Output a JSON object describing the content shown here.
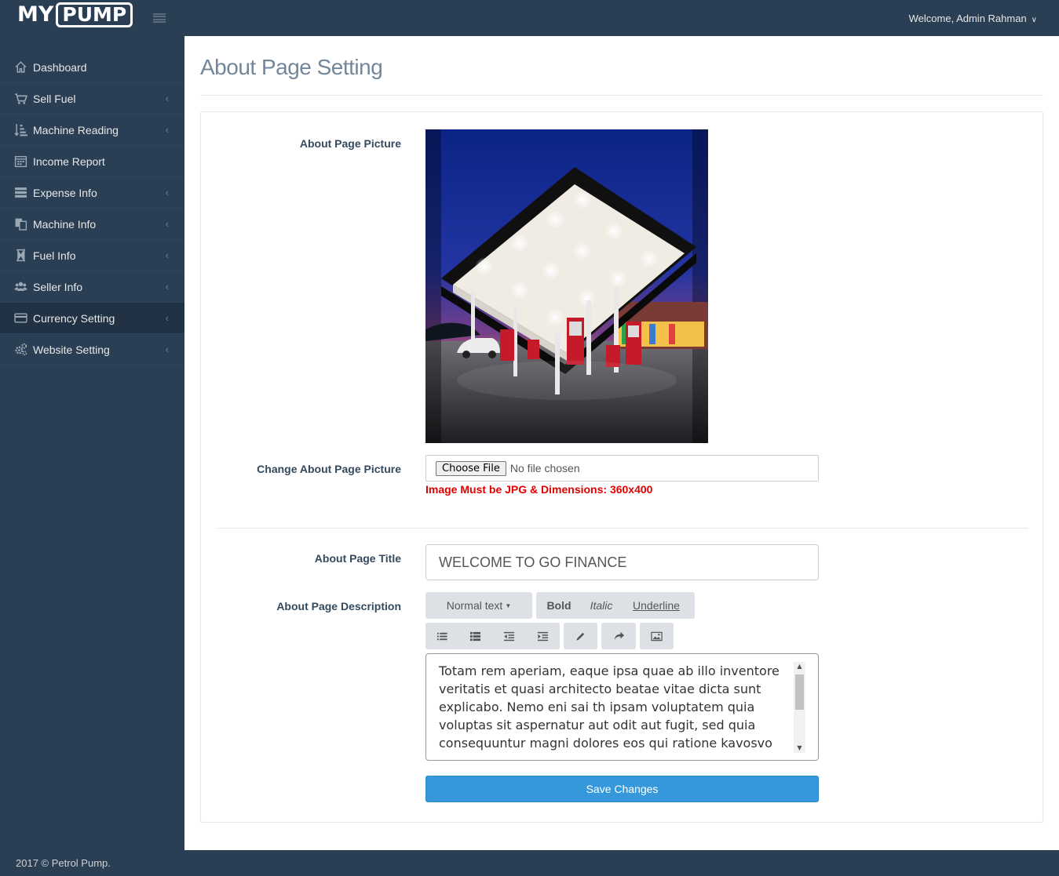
{
  "header": {
    "logo_my": "MY",
    "logo_pump": "PUMP",
    "welcome": "Welcome, Admin Rahman"
  },
  "sidebar": {
    "items": [
      {
        "label": "Dashboard",
        "icon": "home-icon",
        "has_arrow": false
      },
      {
        "label": "Sell Fuel",
        "icon": "cart-icon",
        "has_arrow": true
      },
      {
        "label": "Machine Reading",
        "icon": "sort-amount-icon",
        "has_arrow": true
      },
      {
        "label": "Income Report",
        "icon": "calendar-icon",
        "has_arrow": false
      },
      {
        "label": "Expense Info",
        "icon": "list-icon",
        "has_arrow": true
      },
      {
        "label": "Machine Info",
        "icon": "copy-icon",
        "has_arrow": true
      },
      {
        "label": "Fuel Info",
        "icon": "hourglass-icon",
        "has_arrow": true
      },
      {
        "label": "Seller Info",
        "icon": "users-icon",
        "has_arrow": true
      },
      {
        "label": "Currency Setting",
        "icon": "credit-card-icon",
        "has_arrow": true,
        "active": true
      },
      {
        "label": "Website Setting",
        "icon": "gears-icon",
        "has_arrow": true
      }
    ]
  },
  "footer": "2017 © Petrol Pump.",
  "main": {
    "page_title": "About Page Setting",
    "picture_label": "About Page Picture",
    "change_picture_label": "Change About Page Picture",
    "choose_file": "Choose File",
    "no_file": "No file chosen",
    "file_hint": "Image Must be JPG & Dimensions: 360x400",
    "title_label": "About Page Title",
    "title_value": "WELCOME TO GO FINANCE",
    "description_label": "About Page Description",
    "toolbar": {
      "font_style": "Normal text",
      "bold": "Bold",
      "italic": "Italic",
      "underline": "Underline"
    },
    "description_value": "Totam rem aperiam, eaque ipsa quae ab illo inventore veritatis et quasi architecto beatae vitae dicta sunt explicabo. Nemo eni sai th ipsam voluptatem quia voluptas sit aspernatur aut odit aut fugit, sed quia consequuntur magni dolores eos qui ratione kavosvo",
    "save_button": "Save Changes"
  },
  "colors": {
    "sidebar_bg": "#2a3f54",
    "active_item_bg": "#213244",
    "primary_button": "#3498db",
    "hint_red": "#e00000"
  }
}
